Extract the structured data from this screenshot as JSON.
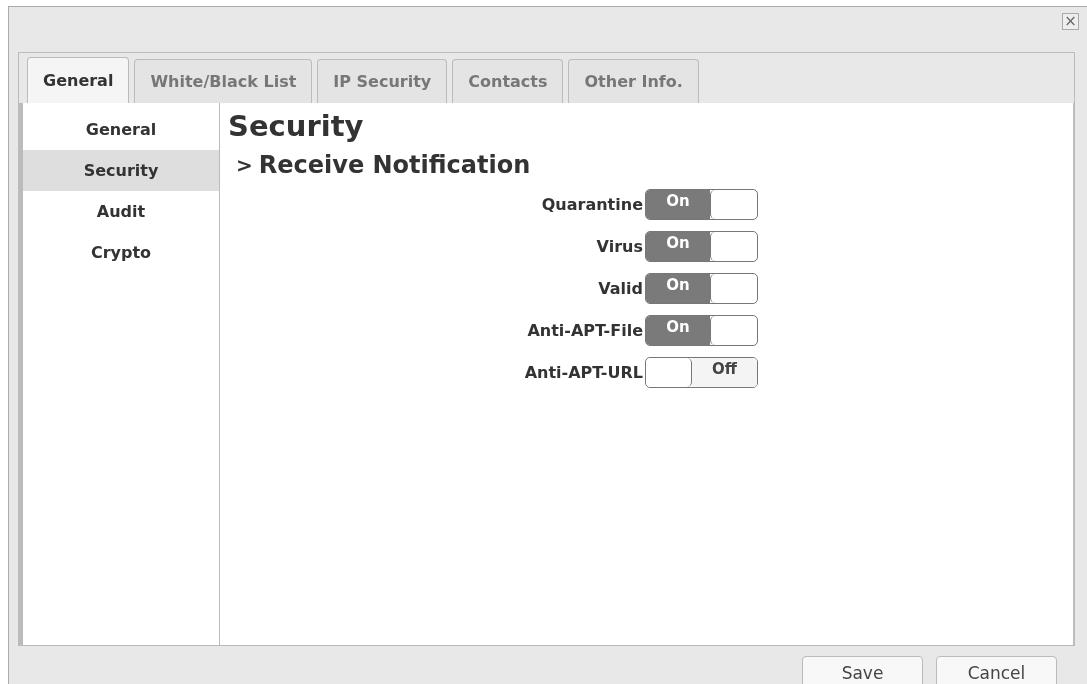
{
  "window": {
    "close": "×"
  },
  "tabs": [
    {
      "label": "General",
      "selected": true
    },
    {
      "label": "White/Black List",
      "selected": false
    },
    {
      "label": "IP Security",
      "selected": false
    },
    {
      "label": "Contacts",
      "selected": false
    },
    {
      "label": "Other Info.",
      "selected": false
    }
  ],
  "sidebar": {
    "items": [
      {
        "label": "General",
        "selected": false
      },
      {
        "label": "Security",
        "selected": true
      },
      {
        "label": "Audit",
        "selected": false
      },
      {
        "label": "Crypto",
        "selected": false
      }
    ]
  },
  "content": {
    "title": "Security",
    "section": {
      "marker": ">",
      "title": "Receive Notification"
    },
    "toggles": [
      {
        "label": "Quarantine",
        "on": true,
        "text": "On"
      },
      {
        "label": "Virus",
        "on": true,
        "text": "On"
      },
      {
        "label": "Valid",
        "on": true,
        "text": "On"
      },
      {
        "label": "Anti-APT-File",
        "on": true,
        "text": "On"
      },
      {
        "label": "Anti-APT-URL",
        "on": false,
        "text": "Off"
      }
    ]
  },
  "buttons": [
    "Save",
    "Cancel"
  ]
}
